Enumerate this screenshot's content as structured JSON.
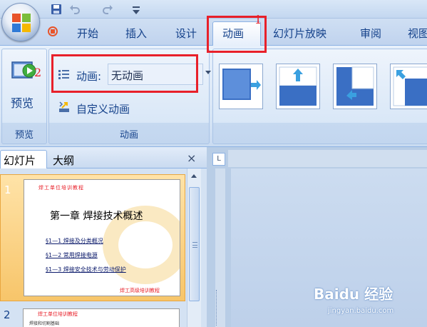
{
  "ribbon_tabs": {
    "home": "开始",
    "insert": "插入",
    "design": "设计",
    "animations": "动画",
    "slideshow": "幻灯片放映",
    "review": "审阅",
    "view": "视图"
  },
  "groups": {
    "preview": {
      "button_label": "预览",
      "group_label": "预览"
    },
    "animations": {
      "animation_label": "动画:",
      "animation_value": "无动画",
      "custom_animation_label": "自定义动画",
      "group_label": "动画"
    }
  },
  "annotations": {
    "marker_1": "1",
    "marker_2": "2"
  },
  "left_pane": {
    "tab_slides": "幻灯片",
    "tab_outline": "大纲",
    "close_glyph": "×"
  },
  "slides": [
    {
      "number": "1",
      "header": "焊工单位培训教程",
      "title": "第一章    焊接技术概述",
      "items": [
        "§1—1  焊接及分类概况",
        "§1—2  常用焊接电源",
        "§1—3  焊接安全技术与劳动保护"
      ],
      "footer": "焊工高级培训教程"
    },
    {
      "number": "2",
      "header": "焊工单位培训教程",
      "subtitle": "焊接和切割基础"
    }
  ],
  "ruler_corner_glyph": "L",
  "watermark": {
    "logo": "Baidu 经验",
    "url": "jingyan.baidu.com"
  },
  "colors": {
    "highlight_red": "#e8202a",
    "ribbon_text": "#15428b",
    "selected_slide": "#f7c56a"
  }
}
